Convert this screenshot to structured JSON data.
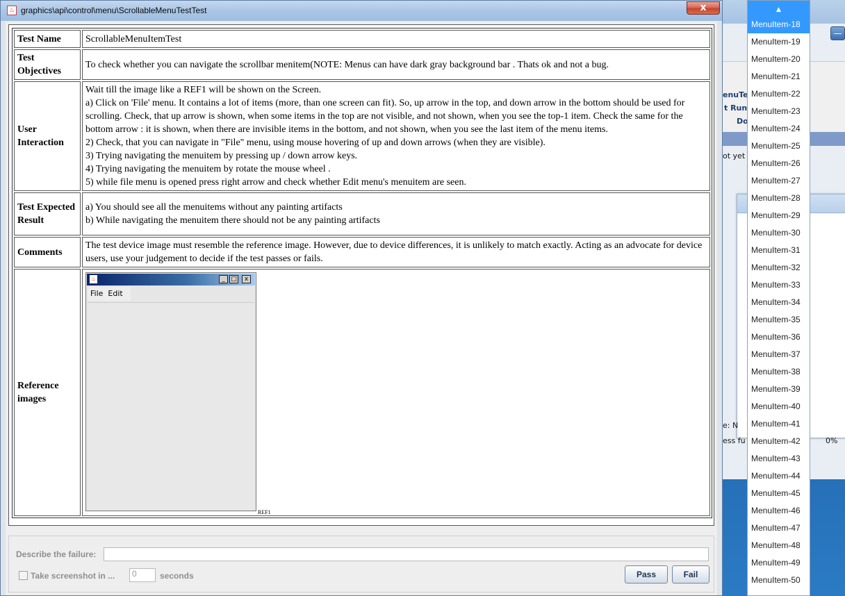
{
  "window": {
    "title": "graphics\\api\\control\\menu\\ScrollableMenuTestTest",
    "close_label": "x"
  },
  "table": {
    "rows": [
      {
        "label": "Test Name",
        "text": "ScrollableMenuItemTest"
      },
      {
        "label": "Test Objectives",
        "text": "To check whether you can navigate the scrollbar menitem(NOTE: Menus can have dark gray background bar . Thats ok and not a bug."
      },
      {
        "label": "User Interaction",
        "text": "Wait till the image like a REF1 will be shown on the Screen.\na) Click on 'File' menu. It contains a lot of items (more, than one screen can fit). So, up arrow in the top, and down arrow in the bottom should be used for scrolling. Check, that up arrow is shown, when some items in the top are not visible, and not shown, when you see the top-1 item. Check the same for the bottom arrow : it is shown, when there are invisible items in the bottom, and not shown, when you see the last item of the menu items.\n2) Check, that you can navigate in \"File\" menu, using mouse hovering of up and down arrows (when they are visible).\n3) Trying navigating the menuitem by pressing up / down arrow keys.\n4) Trying navigating the menuitem by rotate the mouse wheel .\n5) while file menu is opened  press right arrow and check whether Edit menu's menuitem are seen."
      },
      {
        "label": "Test Expected Result",
        "text": "a) You should see all the menuitems without any painting artifacts\nb) While navigating the menuitem there should not be any painting artifacts"
      },
      {
        "label": "Comments",
        "text": "The test device image must resemble the reference image. However, due to device differences, it is unlikely to match exactly. Acting as an advocate for device users, use your judgement to decide if the test passes or fails."
      },
      {
        "label": "Reference images",
        "text": ""
      }
    ]
  },
  "reference": {
    "menu_file": "File",
    "menu_edit": "Edit",
    "caption": "REF1",
    "btn_min": "_",
    "btn_max": "□",
    "btn_close": "x"
  },
  "controls": {
    "describe_label": "Describe the failure:",
    "describe_value": "",
    "screenshot_label": "Take screenshot in ...",
    "seconds_value": "0",
    "seconds_label": "seconds",
    "pass_label": "Pass",
    "fail_label": "Fail"
  },
  "popup": {
    "up_arrow": "▲",
    "items": [
      "MenuItem-18",
      "MenuItem-19",
      "MenuItem-20",
      "MenuItem-21",
      "MenuItem-22",
      "MenuItem-23",
      "MenuItem-24",
      "MenuItem-25",
      "MenuItem-26",
      "MenuItem-27",
      "MenuItem-28",
      "MenuItem-29",
      "MenuItem-30",
      "MenuItem-31",
      "MenuItem-32",
      "MenuItem-33",
      "MenuItem-34",
      "MenuItem-35",
      "MenuItem-36",
      "MenuItem-37",
      "MenuItem-38",
      "MenuItem-39",
      "MenuItem-40",
      "MenuItem-41",
      "MenuItem-42",
      "MenuItem-43",
      "MenuItem-44",
      "MenuItem-45",
      "MenuItem-46",
      "MenuItem-47",
      "MenuItem-48",
      "MenuItem-49",
      "MenuItem-50"
    ],
    "selected_index": 0,
    "colors": {
      "selection": "#3399ff"
    }
  },
  "background": {
    "fragments": [
      "enuTe",
      "t Run M",
      "Do",
      "ot yet",
      "e: N",
      "ess fu",
      "0%"
    ]
  }
}
